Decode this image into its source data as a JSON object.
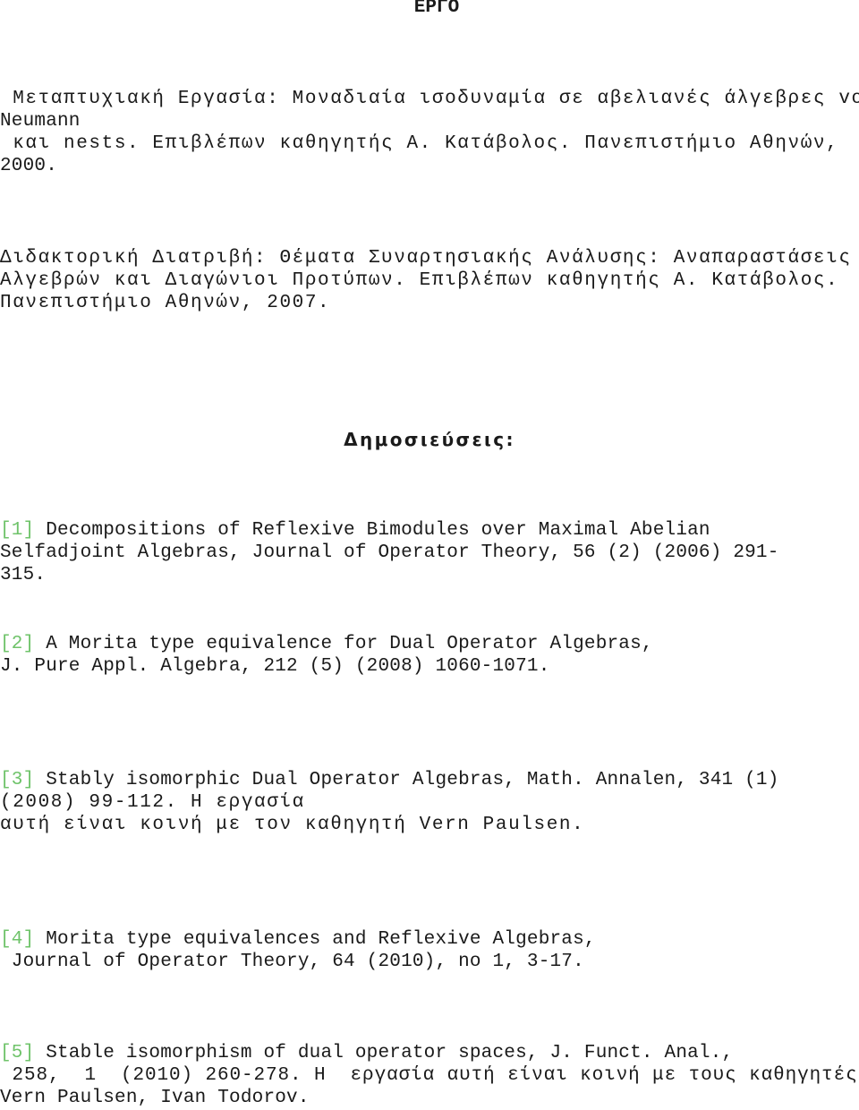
{
  "page": {
    "title": "ΕΡΓΟ"
  },
  "theses": [
    {
      "lines": [
        " Μεταπτυχιακή Εργασία: Μοναδιαία ισοδυναμία σε αβελιανές άλγεβρες von",
        "Neumann",
        " και nests. Επιβλέπων καθηγητής Α. Κατάβολος. Πανεπιστήμιο Αθηνών,",
        "2000."
      ]
    },
    {
      "lines": [
        "Διδακτορική Διατριβή: Θέματα Συναρτησιακής Ανάλυσης: Αναπαραστάσεις",
        "Αλγεβρών και Διαγώνιοι Προτύπων. Επιβλέπων καθηγητής Α. Κατάβολος.",
        "Πανεπιστήμιο Αθηνών, 2007."
      ]
    }
  ],
  "publications": {
    "heading": "Δημοσιεύσεις:",
    "items": [
      {
        "number": "[1]",
        "first_line": " Decompositions of Reflexive Bimodules over Maximal Abelian",
        "rest": [
          "Selfadjoint Algebras, Journal of Operator Theory, 56 (2) (2006) 291-",
          "315."
        ]
      },
      {
        "number": "[2]",
        "first_line": " A Morita type equivalence for Dual Operator Algebras,",
        "rest": [
          "J. Pure Appl. Algebra, 212 (5) (2008) 1060-1071."
        ]
      },
      {
        "number": "[3]",
        "first_line": " Stably isomorphic Dual Operator Algebras, Math. Annalen, 341 (1)",
        "rest": [
          "(2008) 99-112. Η εργασία",
          "αυτή είναι κοινή με τον καθηγητή Vern Paulsen."
        ]
      },
      {
        "number": "[4]",
        "first_line": " Morita type equivalences and Reflexive Algebras,",
        "rest": [
          " Journal of Operator Theory, 64 (2010), no 1, 3-17."
        ]
      },
      {
        "number": "[5]",
        "first_line": " Stable isomorphism of dual operator spaces, J. Funct. Anal.,",
        "rest": [
          " 258,  1  (2010) 260-278. Η  εργασία αυτή είναι κοινή με τους καθηγητές",
          "Vern Paulsen, Ivan Todorov."
        ]
      }
    ]
  },
  "colors": {
    "reference_number": "#6fc36a",
    "text": "#1a1a1a",
    "background": "#ffffff"
  }
}
